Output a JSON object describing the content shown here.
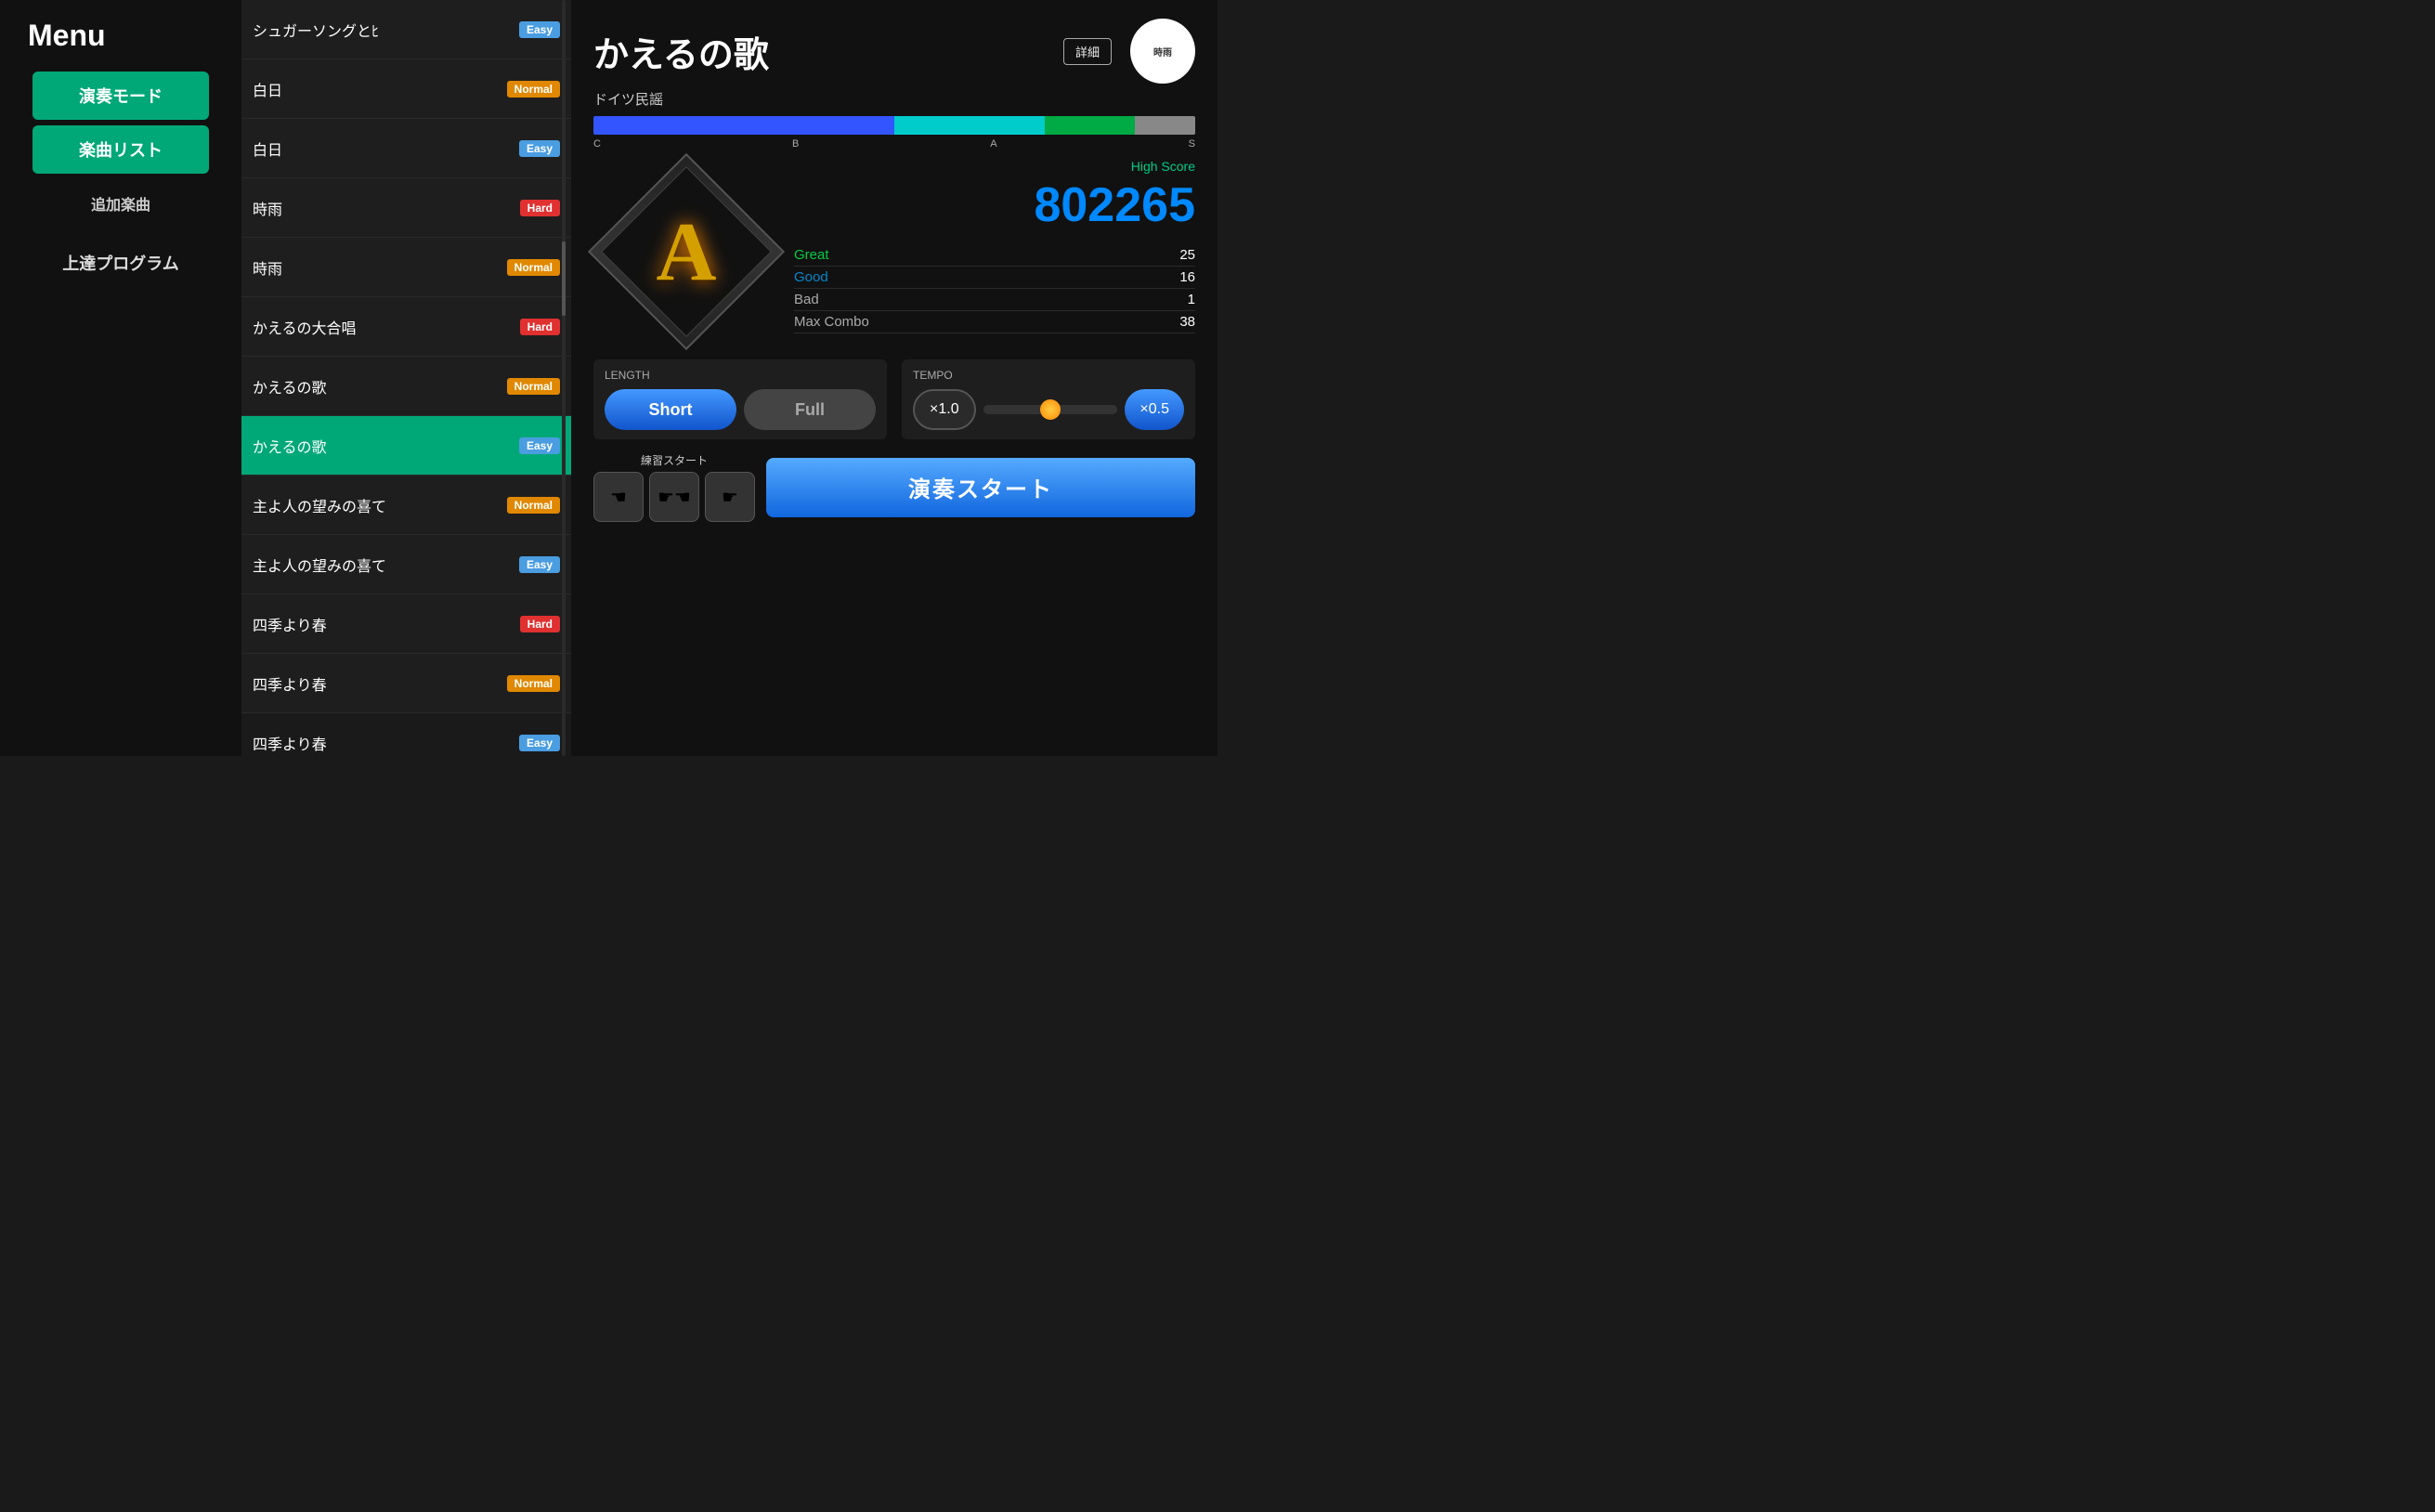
{
  "menu": {
    "title": "Menu",
    "nav_items": [
      {
        "id": "performance-mode",
        "label": "演奏モード",
        "style": "green"
      },
      {
        "id": "song-list",
        "label": "楽曲リスト",
        "style": "green"
      },
      {
        "id": "additional-songs",
        "label": "追加楽曲",
        "style": "text"
      },
      {
        "id": "progress-program",
        "label": "上達プログラム",
        "style": "text"
      }
    ]
  },
  "song_list": {
    "items": [
      {
        "id": "sugar-song",
        "name": "シュガーソングとﾋ",
        "difficulty": "Easy",
        "difficulty_class": "easy",
        "active": false
      },
      {
        "id": "hakujitsu-1",
        "name": "白日",
        "difficulty": "Normal",
        "difficulty_class": "normal",
        "active": false
      },
      {
        "id": "hakujitsu-2",
        "name": "白日",
        "difficulty": "Easy",
        "difficulty_class": "easy",
        "active": false
      },
      {
        "id": "shigure-1",
        "name": "時雨",
        "difficulty": "Hard",
        "difficulty_class": "hard",
        "active": false
      },
      {
        "id": "shigure-2",
        "name": "時雨",
        "difficulty": "Normal",
        "difficulty_class": "normal",
        "active": false
      },
      {
        "id": "kaeru-daigassho",
        "name": "かえるの大合唱",
        "difficulty": "Hard",
        "difficulty_class": "hard",
        "active": false
      },
      {
        "id": "kaeru-uta-normal",
        "name": "かえるの歌",
        "difficulty": "Normal",
        "difficulty_class": "normal",
        "active": false
      },
      {
        "id": "kaeru-uta-easy",
        "name": "かえるの歌",
        "difficulty": "Easy",
        "difficulty_class": "easy",
        "active": true
      },
      {
        "id": "nozomi-1",
        "name": "主よ人の望みの喜て",
        "difficulty": "Normal",
        "difficulty_class": "normal",
        "active": false
      },
      {
        "id": "nozomi-2",
        "name": "主よ人の望みの喜て",
        "difficulty": "Easy",
        "difficulty_class": "easy",
        "active": false
      },
      {
        "id": "shiki-1",
        "name": "四季より春",
        "difficulty": "Hard",
        "difficulty_class": "hard",
        "active": false
      },
      {
        "id": "shiki-2",
        "name": "四季より春",
        "difficulty": "Normal",
        "difficulty_class": "normal",
        "active": false
      },
      {
        "id": "shiki-3",
        "name": "四季より春",
        "difficulty": "Easy",
        "difficulty_class": "easy",
        "active": false
      }
    ]
  },
  "song_detail": {
    "title": "かえるの歌",
    "artist": "ドイツ民謡",
    "detail_btn": "詳細",
    "score_grades": [
      "C",
      "B",
      "A",
      "S"
    ],
    "high_score_label": "High Score",
    "high_score": "802265",
    "stats": [
      {
        "label": "Great",
        "value": "25",
        "class": "great"
      },
      {
        "label": "Good",
        "value": "16",
        "class": "good"
      },
      {
        "label": "Bad",
        "value": "1",
        "class": "bad"
      },
      {
        "label": "Max Combo",
        "value": "38",
        "class": "combo"
      }
    ],
    "length": {
      "label": "LENGTH",
      "options": [
        {
          "id": "short",
          "label": "Short",
          "active": true
        },
        {
          "id": "full",
          "label": "Full",
          "active": false
        }
      ]
    },
    "tempo": {
      "label": "TEMPO",
      "options": [
        {
          "id": "x1",
          "label": "×1.0",
          "active": false
        },
        {
          "id": "x05",
          "label": "×0.5",
          "active": true
        }
      ]
    },
    "practice": {
      "label": "練習スタート",
      "hand_icons": [
        "☚",
        "☛☚",
        "☛"
      ]
    },
    "start_btn": "演奏スタート"
  }
}
